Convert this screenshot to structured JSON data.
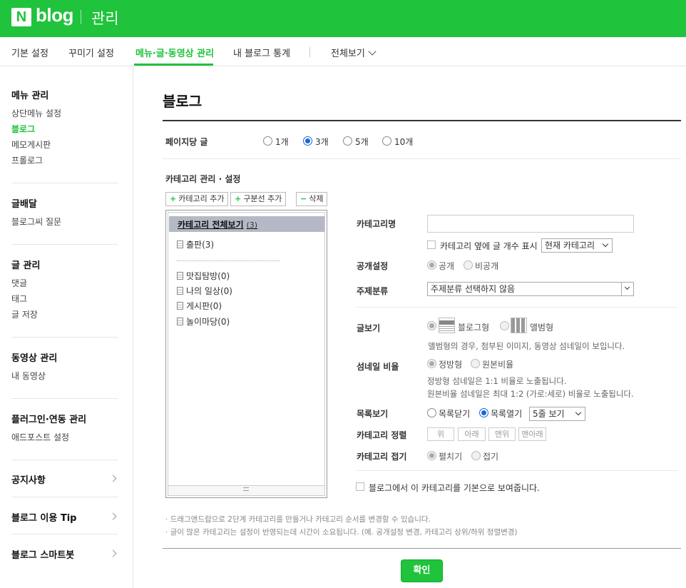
{
  "header": {
    "logo_letter": "N",
    "logo_text": "blog",
    "section_title": "관리"
  },
  "tabs": [
    {
      "label": "기본 설정"
    },
    {
      "label": "꾸미기 설정"
    },
    {
      "label": "메뉴·글·동영상 관리"
    },
    {
      "label": "내 블로그 통계"
    },
    {
      "label": "전체보기"
    }
  ],
  "sidebar": {
    "menu_head": "메뉴 관리",
    "menu_items": [
      "상단메뉴 설정",
      "블로그",
      "메모게시판",
      "프롤로그"
    ],
    "post_head": "글배달",
    "post_items": [
      "블로그씨 질문"
    ],
    "write_head": "글 관리",
    "write_items": [
      "댓글",
      "태그",
      "글 저장"
    ],
    "video_head": "동영상 관리",
    "video_items": [
      "내 동영상"
    ],
    "plugin_head": "플러그인·연동 관리",
    "plugin_items": [
      "애드포스트 설정"
    ],
    "links": [
      "공지사항",
      "블로그 이용 Tip",
      "블로그 스마트봇"
    ]
  },
  "main": {
    "title": "블로그",
    "per_page_label": "페이지당 글",
    "per_page_options": [
      "1개",
      "3개",
      "5개",
      "10개"
    ],
    "per_page_selected": "3개",
    "category_section": "카테고리 관리 · 설정",
    "btn_add_category": "카테고리 추가",
    "btn_add_divider": "구분선 추가",
    "btn_delete": "삭제",
    "tree": {
      "root_label": "카테고리 전체보기",
      "root_count": "(3)",
      "items": [
        "출판(3)",
        "맛집탐방(0)",
        "나의 일상(0)",
        "게시판(0)",
        "놀이마당(0)"
      ]
    },
    "form": {
      "name_label": "카테고리명",
      "show_count_label": "카테고리 옆에 글 개수 표시",
      "show_count_select": "현재 카테고리",
      "public_label": "공개설정",
      "public_options": [
        "공개",
        "비공개"
      ],
      "topic_label": "주제분류",
      "topic_select": "주제분류 선택하지 않음",
      "view_label": "글보기",
      "view_options": [
        "블로그형",
        "앨범형"
      ],
      "view_note": "앨범형의 경우, 첨부된 이미지, 동영상 섬네일이 보입니다.",
      "thumb_label": "섬네일 비율",
      "thumb_options": [
        "정방형",
        "원본비율"
      ],
      "thumb_note1": "정방형 섬네일은 1:1 비율로 노출됩니다.",
      "thumb_note2": "원본비율 섬네일은 최대 1:2 (가로:세로) 비율로 노출됩니다.",
      "list_label": "목록보기",
      "list_options": [
        "목록닫기",
        "목록열기"
      ],
      "list_select": "5줄 보기",
      "sort_label": "카테고리 정렬",
      "sort_buttons": [
        "위",
        "아래",
        "맨위",
        "맨아래"
      ],
      "fold_label": "카테고리 접기",
      "fold_options": [
        "펼치기",
        "접기"
      ],
      "default_label": "블로그에서 이 카테고리를 기본으로 보여줍니다."
    },
    "footnote1": "드래그앤드랍으로 2단계 카테고리를 만들거나 카테고리 순서를 변경할 수 있습니다.",
    "footnote2": "글이 많은 카테고리는 설정이 반영되는데 시간이 소요됩니다. (예. 공개설정 변경, 카테고리 상위/하위 정렬변경)",
    "confirm": "확인"
  },
  "colors": {
    "brand_green": "#20c33c",
    "radio_blue": "#1a66d6"
  }
}
